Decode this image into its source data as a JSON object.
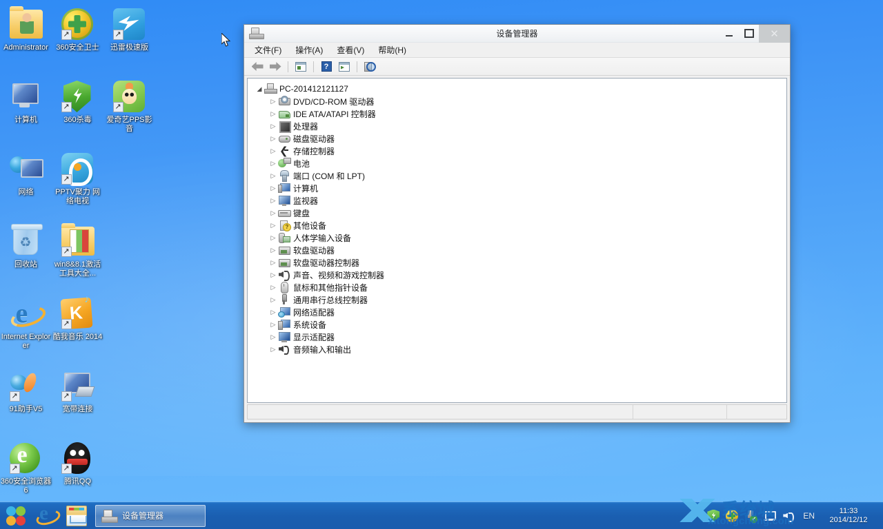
{
  "desktop": {
    "icons": [
      {
        "label": "Administrator",
        "icon": "user-folder-icon",
        "art": "ic-folder-user",
        "shortcut": false
      },
      {
        "label": "360安全卫士",
        "icon": "360-safe-guard-icon",
        "art": "ic-360guard",
        "shortcut": true
      },
      {
        "label": "迅雷极速版",
        "icon": "thunder-download-icon",
        "art": "ic-thunder",
        "shortcut": true
      },
      {
        "label": "计算机",
        "icon": "computer-icon",
        "art": "ic-computer",
        "shortcut": false
      },
      {
        "label": "360杀毒",
        "icon": "360-antivirus-icon",
        "art": "ic-360anti",
        "shortcut": true
      },
      {
        "label": "爱奇艺PPS影音",
        "icon": "iqiyi-pps-icon",
        "art": "ic-pps",
        "shortcut": true
      },
      {
        "label": "网络",
        "icon": "network-icon",
        "art": "ic-network",
        "shortcut": false
      },
      {
        "label": "PPTV聚力 网络电视",
        "icon": "pptv-icon",
        "art": "ic-pptv",
        "shortcut": true
      },
      {
        "label": "",
        "icon": "empty-cell",
        "art": "",
        "shortcut": false
      },
      {
        "label": "回收站",
        "icon": "recycle-bin-icon",
        "art": "ic-recycle",
        "shortcut": false
      },
      {
        "label": "win8&8.1激活工具大全...",
        "icon": "folder-icon",
        "art": "ic-folder-win",
        "shortcut": true
      },
      {
        "label": "",
        "icon": "empty-cell",
        "art": "",
        "shortcut": false
      },
      {
        "label": "Internet Explorer",
        "icon": "internet-explorer-icon",
        "art": "ic-ie",
        "shortcut": false
      },
      {
        "label": "酷我音乐 2014",
        "icon": "kuwo-music-icon",
        "art": "ic-kuwo",
        "shortcut": true
      },
      {
        "label": "",
        "icon": "empty-cell",
        "art": "",
        "shortcut": false
      },
      {
        "label": "91助手V5",
        "icon": "91-assistant-icon",
        "art": "ic-91",
        "shortcut": true
      },
      {
        "label": "宽带连接",
        "icon": "broadband-connection-icon",
        "art": "ic-broadband",
        "shortcut": true
      },
      {
        "label": "",
        "icon": "empty-cell",
        "art": "",
        "shortcut": false
      },
      {
        "label": "360安全浏览器6",
        "icon": "360-browser-icon",
        "art": "ic-360browser",
        "shortcut": true
      },
      {
        "label": "腾讯QQ",
        "icon": "tencent-qq-icon",
        "art": "ic-qq",
        "shortcut": true
      },
      {
        "label": "",
        "icon": "empty-cell",
        "art": "",
        "shortcut": false
      }
    ]
  },
  "window": {
    "title": "设备管理器",
    "title_icon": "device-manager-icon",
    "buttons": {
      "minimize": "–",
      "maximize": "□",
      "close": "✕"
    },
    "menu": [
      {
        "label": "文件(F)",
        "name": "menu-file"
      },
      {
        "label": "操作(A)",
        "name": "menu-action"
      },
      {
        "label": "查看(V)",
        "name": "menu-view"
      },
      {
        "label": "帮助(H)",
        "name": "menu-help"
      }
    ],
    "toolbar": [
      {
        "name": "back-arrow-icon",
        "art": "arrow-l",
        "title": "后退"
      },
      {
        "name": "forward-arrow-icon",
        "art": "arrow-r",
        "title": "前进"
      },
      {
        "name": "separator-1",
        "art": "sep",
        "title": ""
      },
      {
        "name": "show-console-tree-icon",
        "art": "panel",
        "title": "显示/隐藏控制台树"
      },
      {
        "name": "separator-2",
        "art": "sep",
        "title": ""
      },
      {
        "name": "help-icon",
        "art": "help",
        "title": "帮助"
      },
      {
        "name": "properties-icon",
        "art": "panel-play",
        "title": "属性"
      },
      {
        "name": "separator-3",
        "art": "sep",
        "title": ""
      },
      {
        "name": "scan-hardware-changes-icon",
        "art": "scan",
        "title": "扫描检测硬件改动"
      }
    ],
    "tree": {
      "root": {
        "label": "PC-201412121127",
        "icon": "computer-node-icon",
        "art": "ti-pc",
        "arrow": "◢",
        "expanded": true
      },
      "children": [
        {
          "label": "DVD/CD-ROM 驱动器",
          "icon": "dvd-drive-icon",
          "art": "ti-dvd",
          "arrow": "▷"
        },
        {
          "label": "IDE ATA/ATAPI 控制器",
          "icon": "ide-controller-icon",
          "art": "ti-ide",
          "arrow": "▷"
        },
        {
          "label": "处理器",
          "icon": "processor-icon",
          "art": "ti-cpu",
          "arrow": "▷"
        },
        {
          "label": "磁盘驱动器",
          "icon": "disk-drive-icon",
          "art": "ti-disk",
          "arrow": "▷"
        },
        {
          "label": "存储控制器",
          "icon": "storage-controller-icon",
          "art": "ti-storage",
          "arrow": "▷"
        },
        {
          "label": "电池",
          "icon": "battery-icon",
          "art": "ti-battery",
          "arrow": "▷"
        },
        {
          "label": "端口 (COM 和 LPT)",
          "icon": "ports-icon",
          "art": "ti-port",
          "arrow": "▷"
        },
        {
          "label": "计算机",
          "icon": "computer-icon",
          "art": "ti-pcmon",
          "arrow": "▷"
        },
        {
          "label": "监视器",
          "icon": "monitor-icon",
          "art": "ti-monitor",
          "arrow": "▷"
        },
        {
          "label": "键盘",
          "icon": "keyboard-icon",
          "art": "ti-keyboard",
          "arrow": "▷"
        },
        {
          "label": "其他设备",
          "icon": "other-devices-icon",
          "art": "ti-other",
          "arrow": "▷"
        },
        {
          "label": "人体学输入设备",
          "icon": "hid-devices-icon",
          "art": "ti-hid",
          "arrow": "▷"
        },
        {
          "label": "软盘驱动器",
          "icon": "floppy-drive-icon",
          "art": "ti-floppy",
          "arrow": "▷"
        },
        {
          "label": "软盘驱动器控制器",
          "icon": "floppy-controller-icon",
          "art": "ti-floppy",
          "arrow": "▷"
        },
        {
          "label": "声音、视频和游戏控制器",
          "icon": "sound-video-game-controller-icon",
          "art": "ti-sound",
          "arrow": "▷"
        },
        {
          "label": "鼠标和其他指针设备",
          "icon": "mouse-pointing-devices-icon",
          "art": "ti-mouse",
          "arrow": "▷"
        },
        {
          "label": "通用串行总线控制器",
          "icon": "usb-controller-icon",
          "art": "ti-usb",
          "arrow": "▷"
        },
        {
          "label": "网络适配器",
          "icon": "network-adapter-icon",
          "art": "ti-netadapter",
          "arrow": "▷"
        },
        {
          "label": "系统设备",
          "icon": "system-devices-icon",
          "art": "ti-sysdev",
          "arrow": "▷"
        },
        {
          "label": "显示适配器",
          "icon": "display-adapter-icon",
          "art": "ti-display",
          "arrow": "▷"
        },
        {
          "label": "音频输入和输出",
          "icon": "audio-io-icon",
          "art": "ti-audioio",
          "arrow": "▷"
        }
      ]
    },
    "statusbar": {
      "pane1": "",
      "pane2": "",
      "pane3": ""
    }
  },
  "taskbar": {
    "quick_launch": [
      {
        "name": "start-orb-icon",
        "art": "qi-start"
      },
      {
        "name": "internet-explorer-icon",
        "art": "qi-ie"
      },
      {
        "name": "file-explorer-icon",
        "art": "qi-explorer"
      }
    ],
    "task_button": {
      "label": "设备管理器",
      "icon": "device-manager-icon",
      "active": true
    },
    "tray": [
      {
        "name": "360-antivirus-tray-icon",
        "art": "tr-shield"
      },
      {
        "name": "360-safe-guard-tray-icon",
        "art": "tr-360"
      },
      {
        "name": "safely-remove-hardware-icon",
        "art": "tr-usb"
      },
      {
        "name": "network-tray-icon",
        "art": "tr-net"
      },
      {
        "name": "volume-tray-icon",
        "art": "tr-vol"
      }
    ],
    "language": "EN",
    "clock": {
      "time": "11:33",
      "date": "2014/12/12"
    }
  },
  "watermark": {
    "brand": "系统城",
    "url": "xitongcheng.com"
  }
}
